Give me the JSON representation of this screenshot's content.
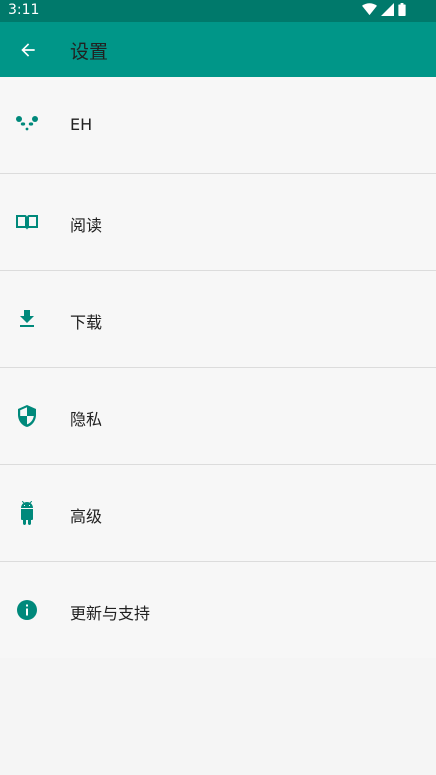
{
  "status_bar": {
    "time": "3:11"
  },
  "toolbar": {
    "title": "设置",
    "back_icon": "arrow-back-icon"
  },
  "colors": {
    "primary": "#009688",
    "primary_dark": "#00796b",
    "icon": "#00897b",
    "text": "#212121"
  },
  "items": [
    {
      "label": "EH",
      "icon": "panda-icon"
    },
    {
      "label": "阅读",
      "icon": "book-icon"
    },
    {
      "label": "下载",
      "icon": "download-icon"
    },
    {
      "label": "隐私",
      "icon": "shield-icon"
    },
    {
      "label": "高级",
      "icon": "android-icon"
    },
    {
      "label": "更新与支持",
      "icon": "info-icon"
    }
  ]
}
